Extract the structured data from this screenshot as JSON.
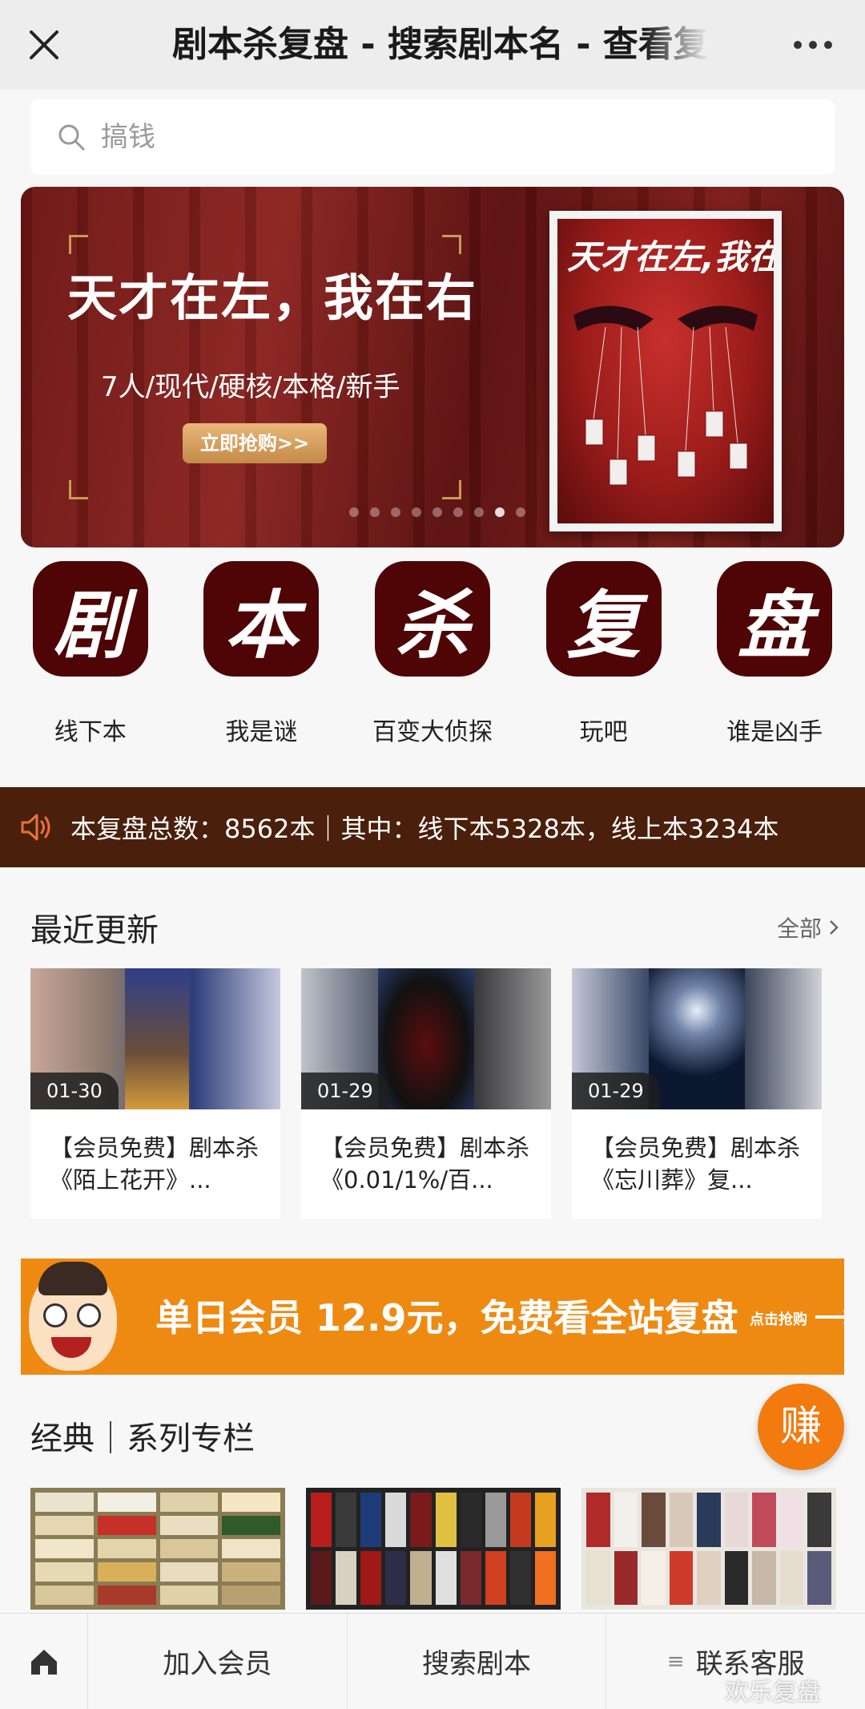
{
  "header": {
    "title": "剧本杀复盘 - 搜索剧本名 - 查看复盘"
  },
  "search": {
    "placeholder": "搞钱"
  },
  "banner": {
    "title": "天才在左，我在右",
    "subtitle": "7人/现代/硬核/本格/新手",
    "button": "立即抢购>>",
    "poster_title": "天才在左,我在右"
  },
  "categories": [
    {
      "glyph": "剧",
      "label": "线下本"
    },
    {
      "glyph": "本",
      "label": "我是谜"
    },
    {
      "glyph": "杀",
      "label": "百变大侦探"
    },
    {
      "glyph": "复",
      "label": "玩吧"
    },
    {
      "glyph": "盘",
      "label": "谁是凶手"
    }
  ],
  "notice": {
    "icon": "speaker-icon",
    "text": "本复盘总数：8562本｜其中：线下本5328本，线上本3234本"
  },
  "recent": {
    "heading": "最近更新",
    "all_label": "全部",
    "items": [
      {
        "date": "01-30",
        "title": "【会员免费】剧本杀《陌上花开》..."
      },
      {
        "date": "01-29",
        "title": "【会员免费】剧本杀《0.01/1%/百..."
      },
      {
        "date": "01-29",
        "title": "【会员免费】剧本杀《忘川葬》复..."
      }
    ]
  },
  "ad": {
    "text": "单日会员  12.9元，免费看全站复盘",
    "cta": "点击抢购"
  },
  "earn_button": "赚",
  "series": {
    "heading": "经典｜系列专栏"
  },
  "bottom_nav": {
    "home_icon": "home-icon",
    "items": [
      "加入会员",
      "搜索剧本",
      "联系客服"
    ]
  },
  "watermark": "欢乐复盘",
  "colors": {
    "brand_dark_red": "#4f0505",
    "notice_bg": "#4a1f0b",
    "ad_orange": "#ee8a12",
    "earn_orange": "#f27a0e"
  }
}
